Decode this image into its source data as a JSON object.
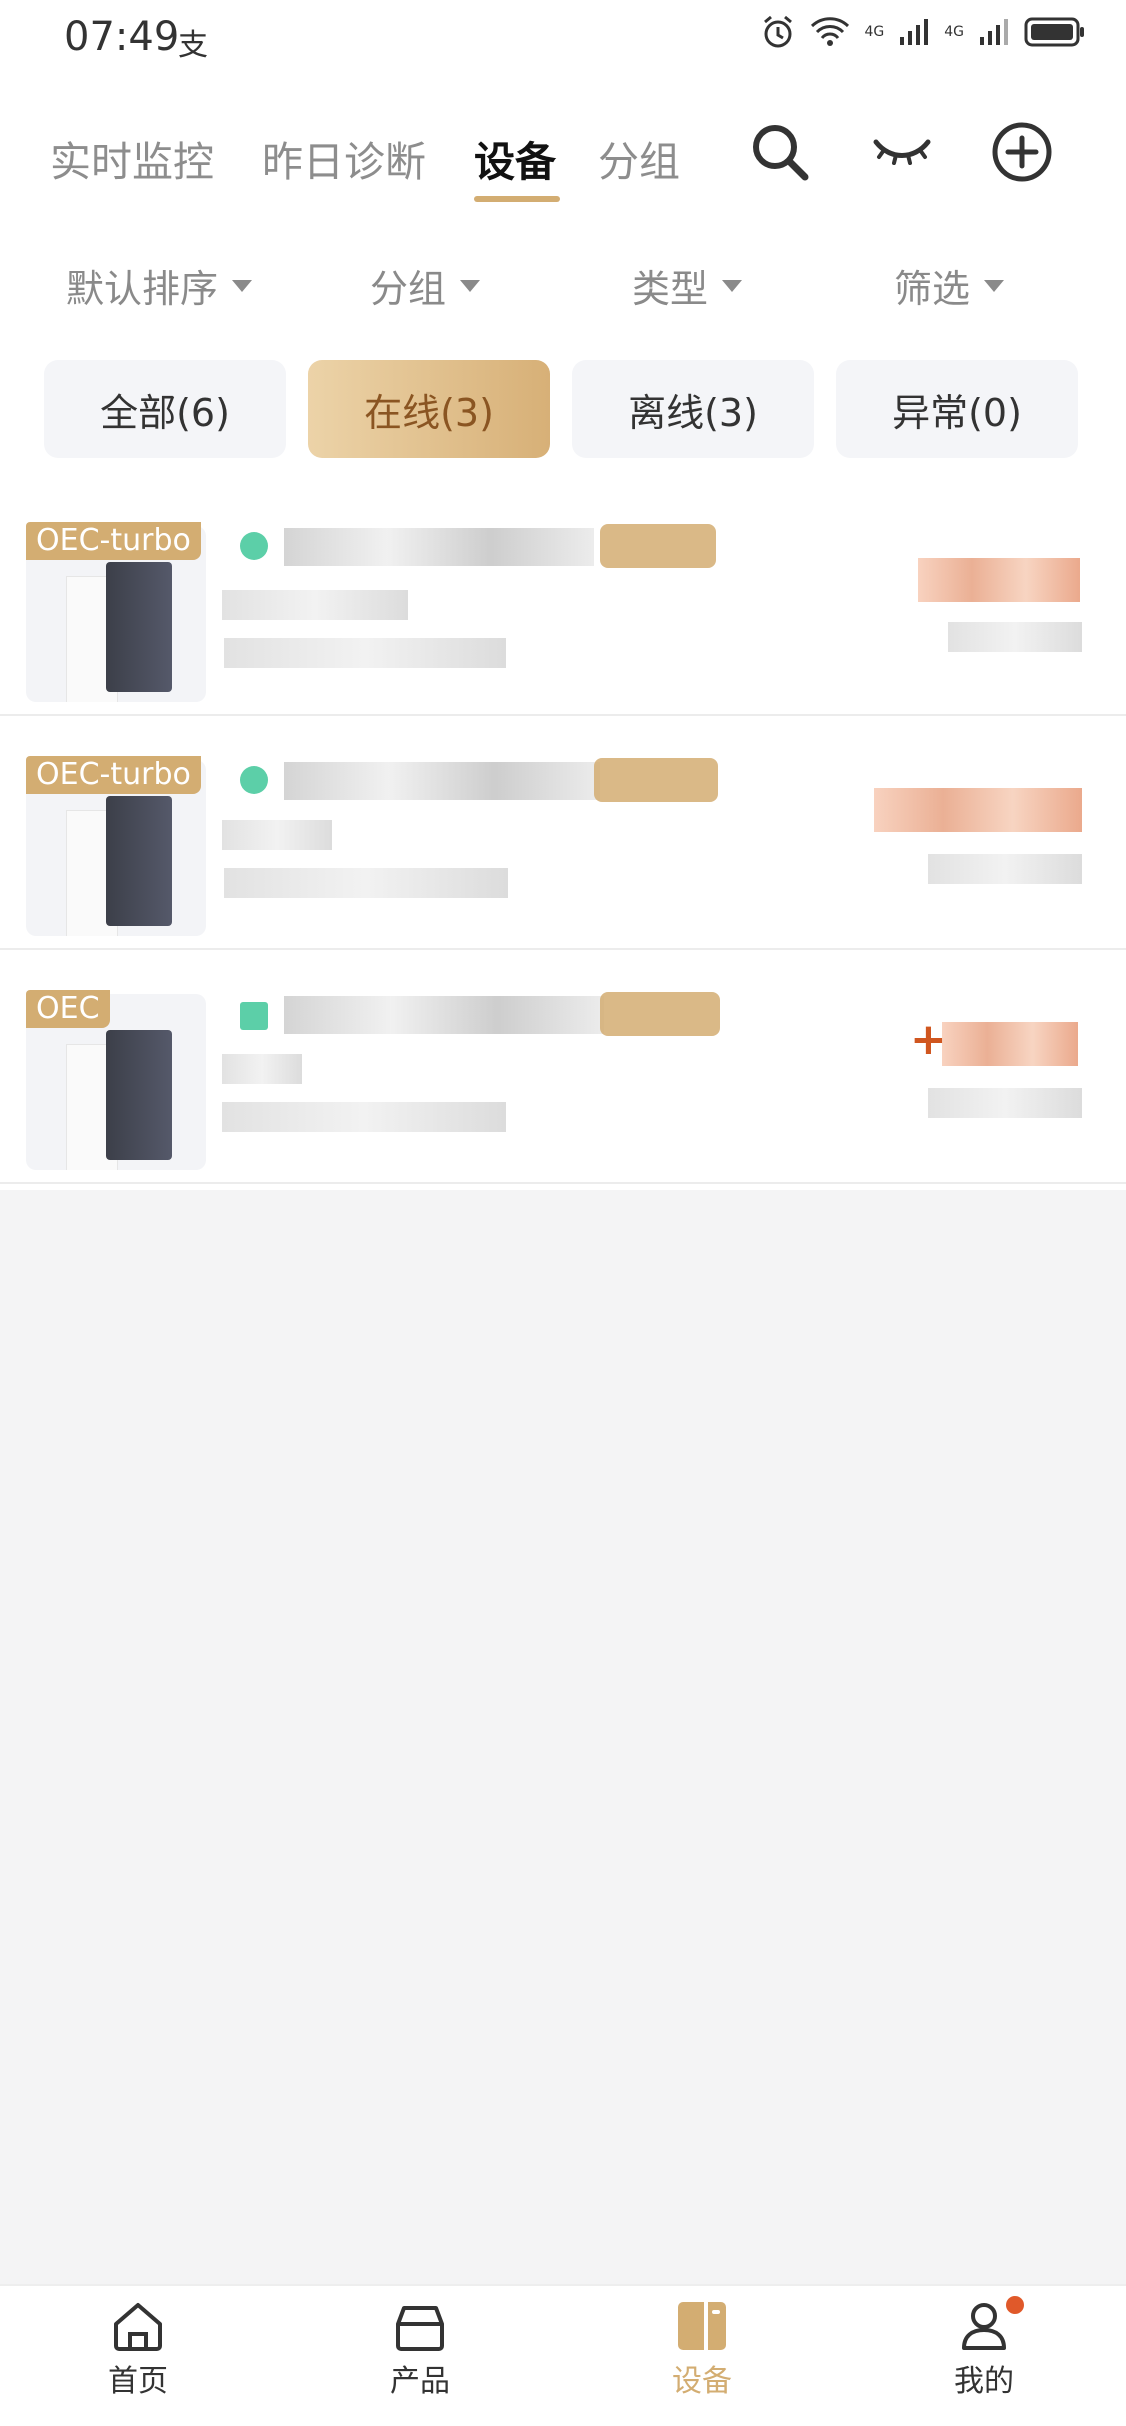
{
  "status_bar": {
    "time": "07:49",
    "network_1": "4G",
    "network_2": "4G"
  },
  "header": {
    "tabs": [
      {
        "label": "实时监控"
      },
      {
        "label": "昨日诊断"
      },
      {
        "label": "设备"
      },
      {
        "label": "分组"
      }
    ],
    "active_tab": "设备"
  },
  "filters": [
    "默认排序",
    "分组",
    "类型",
    "筛选"
  ],
  "segments": [
    {
      "label": "全部(6)"
    },
    {
      "label": "在线(3)"
    },
    {
      "label": "离线(3)"
    },
    {
      "label": "异常(0)"
    }
  ],
  "devices": [
    {
      "tag": "OEC-turbo",
      "status": "online"
    },
    {
      "tag": "OEC-turbo",
      "status": "online"
    },
    {
      "tag": "OEC",
      "status": "online",
      "value_sign": "+"
    }
  ],
  "bottom_nav": [
    {
      "label": "首页",
      "icon": "home-icon"
    },
    {
      "label": "产品",
      "icon": "bag-icon"
    },
    {
      "label": "设备",
      "icon": "device-icon"
    },
    {
      "label": "我的",
      "icon": "profile-icon"
    }
  ],
  "colors": {
    "accent": "#d3ad72",
    "online": "#5ccfa8",
    "value": "#d0561f"
  }
}
